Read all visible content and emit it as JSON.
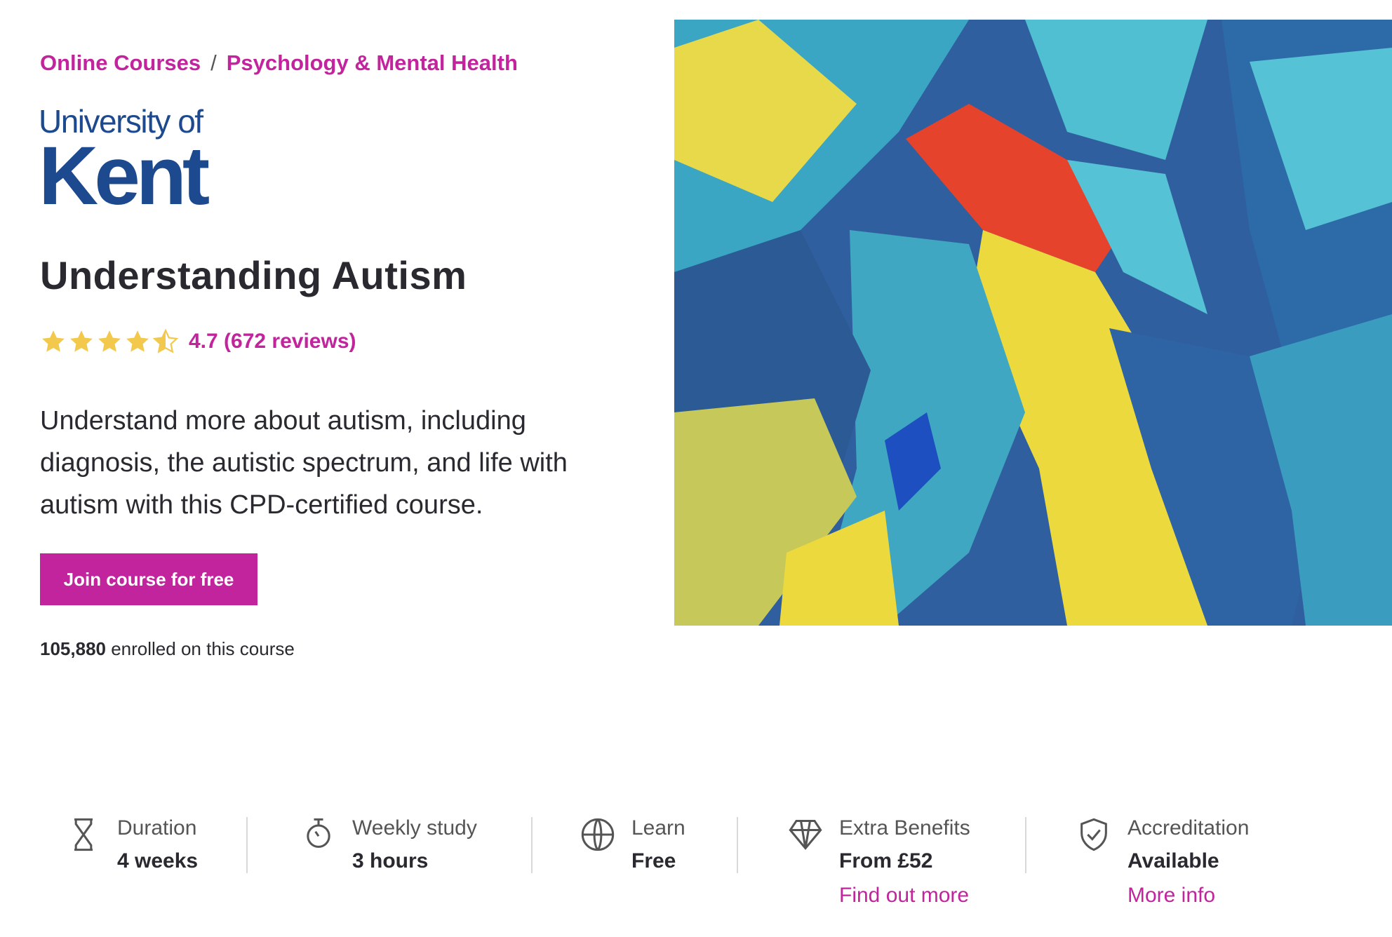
{
  "breadcrumb": {
    "items": [
      "Online Courses",
      "Psychology & Mental Health"
    ],
    "separator": "/"
  },
  "logo": {
    "line1": "University of",
    "line2": "Kent"
  },
  "course": {
    "title": "Understanding Autism",
    "rating": 4.7,
    "rating_text": "4.7 (672 reviews)",
    "description": "Understand more about autism, including diagnosis, the autistic spectrum, and life with autism with this CPD-certified course.",
    "join_label": "Join course for free",
    "enrolled_count": "105,880",
    "enrolled_suffix": "enrolled on this course"
  },
  "colors": {
    "accent": "#c1249c",
    "star": "#f2c94c",
    "brand_blue": "#1d4a8f"
  },
  "meta": [
    {
      "icon": "hourglass-icon",
      "label": "Duration",
      "value": "4 weeks"
    },
    {
      "icon": "stopwatch-icon",
      "label": "Weekly study",
      "value": "3 hours"
    },
    {
      "icon": "globe-icon",
      "label": "Learn",
      "value": "Free"
    },
    {
      "icon": "diamond-icon",
      "label": "Extra Benefits",
      "value": "From £52",
      "link": "Find out more"
    },
    {
      "icon": "shield-check-icon",
      "label": "Accreditation",
      "value": "Available",
      "link": "More info"
    }
  ]
}
